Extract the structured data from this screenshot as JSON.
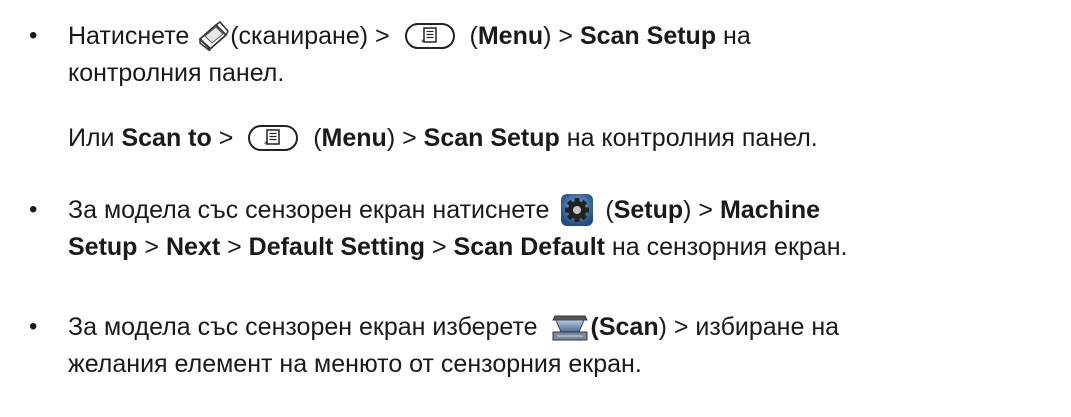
{
  "bullets": [
    {
      "symbol": "•",
      "line1": {
        "t1": "Натиснете ",
        "t2": "(сканиране) > ",
        "t3": " (",
        "b1": "Menu",
        "t4": ") > ",
        "b2": "Scan Setup",
        "t5": " на"
      },
      "line2": {
        "t1": "контролния панел."
      },
      "line3": {
        "t1": "Или ",
        "b1": "Scan to",
        "t2": " > ",
        "t3": " (",
        "b2": "Menu",
        "t4": ") > ",
        "b3": "Scan Setup",
        "t5": " на контролния панел."
      }
    },
    {
      "symbol": "•",
      "line1": {
        "t1": "За модела със сензорен екран натиснете ",
        "t2": " (",
        "b1": "Setup",
        "t3": ") > ",
        "b2": "Machine"
      },
      "line2": {
        "b1": "Setup",
        "t1": " > ",
        "b2": "Next",
        "t2": " > ",
        "b3": "Default Setting",
        "t3": " > ",
        "b4": "Scan Default",
        "t4": " на сензорния екран."
      }
    },
    {
      "symbol": "•",
      "line1": {
        "t1": "За модела със сензорен екран изберете ",
        "b1": "(Scan",
        "t2": ") > избиране на"
      },
      "line2": {
        "t1": "желания елемент на менюто от сензорния екран."
      }
    }
  ],
  "icons": {
    "scan_key": "scanner-key-icon",
    "menu_key": "menu-key-icon",
    "setup": "gear-setup-icon",
    "scan": "flatbed-scanner-icon"
  },
  "colors": {
    "text": "#1a1a1a",
    "setup_icon": "#2f5f9a",
    "scan_icon": "#6b8bb0"
  }
}
